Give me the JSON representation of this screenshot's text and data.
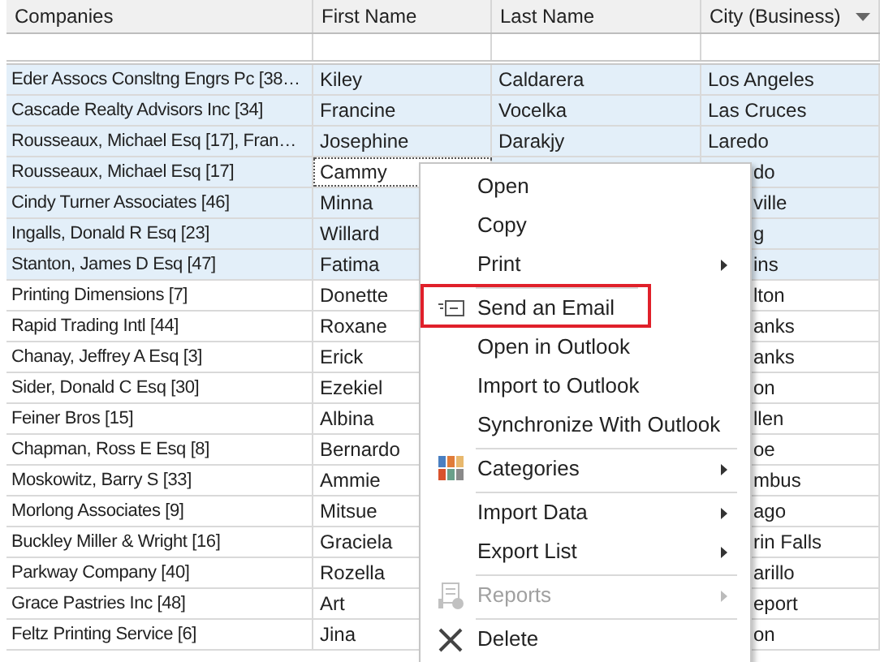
{
  "table": {
    "columns": [
      {
        "label": "Companies",
        "dropdown": false
      },
      {
        "label": "First Name",
        "dropdown": false
      },
      {
        "label": "Last Name",
        "dropdown": false
      },
      {
        "label": "City (Business)",
        "dropdown": true
      }
    ],
    "rows": [
      {
        "company": "Eder Assocs Consltng Engrs Pc [38…",
        "first": "Kiley",
        "last": "Caldarera",
        "city": "Los Angeles",
        "selected": true,
        "focused": false,
        "covered": false
      },
      {
        "company": "Cascade Realty Advisors Inc [34]",
        "first": "Francine",
        "last": "Vocelka",
        "city": "Las Cruces",
        "selected": true,
        "focused": false,
        "covered": false
      },
      {
        "company": "Rousseaux, Michael Esq [17], Fran…",
        "first": "Josephine",
        "last": "Darakjy",
        "city": "Laredo",
        "selected": true,
        "focused": false,
        "covered": false
      },
      {
        "company": "Rousseaux, Michael Esq [17]",
        "first": "Cammy",
        "city": "do",
        "selected": true,
        "focused": true,
        "covered": true
      },
      {
        "company": "Cindy Turner Associates [46]",
        "first": "Minna",
        "city": "ville",
        "selected": true,
        "focused": false,
        "covered": true
      },
      {
        "company": "Ingalls, Donald R Esq [23]",
        "first": "Willard",
        "city": "g",
        "selected": true,
        "focused": false,
        "covered": true
      },
      {
        "company": "Stanton, James D Esq [47]",
        "first": "Fatima",
        "city": "ins",
        "selected": true,
        "focused": false,
        "covered": true
      },
      {
        "company": "Printing Dimensions [7]",
        "first": "Donette",
        "city": "lton",
        "selected": false,
        "focused": false,
        "covered": true
      },
      {
        "company": "Rapid Trading Intl [44]",
        "first": "Roxane",
        "city": "anks",
        "selected": false,
        "focused": false,
        "covered": true
      },
      {
        "company": "Chanay, Jeffrey A Esq [3]",
        "first": "Erick",
        "city": "anks",
        "selected": false,
        "focused": false,
        "covered": true
      },
      {
        "company": "Sider, Donald C Esq [30]",
        "first": "Ezekiel",
        "city": "on",
        "selected": false,
        "focused": false,
        "covered": true
      },
      {
        "company": "Feiner Bros [15]",
        "first": "Albina",
        "city": "llen",
        "selected": false,
        "focused": false,
        "covered": true
      },
      {
        "company": "Chapman, Ross E Esq [8]",
        "first": "Bernardo",
        "city": "oe",
        "selected": false,
        "focused": false,
        "covered": true
      },
      {
        "company": "Moskowitz, Barry S [33]",
        "first": "Ammie",
        "city": "mbus",
        "selected": false,
        "focused": false,
        "covered": true
      },
      {
        "company": "Morlong Associates [9]",
        "first": "Mitsue",
        "city": "ago",
        "selected": false,
        "focused": false,
        "covered": true
      },
      {
        "company": "Buckley Miller & Wright [16]",
        "first": "Graciela",
        "city": "rin Falls",
        "selected": false,
        "focused": false,
        "covered": true
      },
      {
        "company": "Parkway Company [40]",
        "first": "Rozella",
        "city": "arillo",
        "selected": false,
        "focused": false,
        "covered": true
      },
      {
        "company": "Grace Pastries Inc [48]",
        "first": "Art",
        "city": "eport",
        "selected": false,
        "focused": false,
        "covered": true
      },
      {
        "company": "Feltz Printing Service [6]",
        "first": "Jina",
        "city": "on",
        "selected": false,
        "focused": false,
        "covered": true
      }
    ]
  },
  "context_menu": {
    "items": [
      {
        "label": "Open",
        "kind": "plain",
        "submenu": false,
        "disabled": false,
        "highlighted": false,
        "separator_before": false
      },
      {
        "label": "Copy",
        "kind": "plain",
        "submenu": false,
        "disabled": false,
        "highlighted": false,
        "separator_before": false
      },
      {
        "label": "Print",
        "kind": "plain",
        "submenu": true,
        "disabled": false,
        "highlighted": false,
        "separator_before": false
      },
      {
        "label": "Send an Email",
        "kind": "email",
        "submenu": false,
        "disabled": false,
        "highlighted": true,
        "separator_before": true
      },
      {
        "label": "Open in Outlook",
        "kind": "plain",
        "submenu": false,
        "disabled": false,
        "highlighted": false,
        "separator_before": false
      },
      {
        "label": "Import to Outlook",
        "kind": "plain",
        "submenu": false,
        "disabled": false,
        "highlighted": false,
        "separator_before": false
      },
      {
        "label": "Synchronize With Outlook",
        "kind": "plain",
        "submenu": false,
        "disabled": false,
        "highlighted": false,
        "separator_before": false
      },
      {
        "label": "Categories",
        "kind": "categories",
        "submenu": true,
        "disabled": false,
        "highlighted": false,
        "separator_before": true
      },
      {
        "label": "Import Data",
        "kind": "plain",
        "submenu": true,
        "disabled": false,
        "highlighted": false,
        "separator_before": true
      },
      {
        "label": "Export List",
        "kind": "plain",
        "submenu": true,
        "disabled": false,
        "highlighted": false,
        "separator_before": false
      },
      {
        "label": "Reports",
        "kind": "reports",
        "submenu": true,
        "disabled": true,
        "highlighted": false,
        "separator_before": true
      },
      {
        "label": "Delete",
        "kind": "delete",
        "submenu": false,
        "disabled": false,
        "highlighted": false,
        "separator_before": true
      }
    ]
  }
}
